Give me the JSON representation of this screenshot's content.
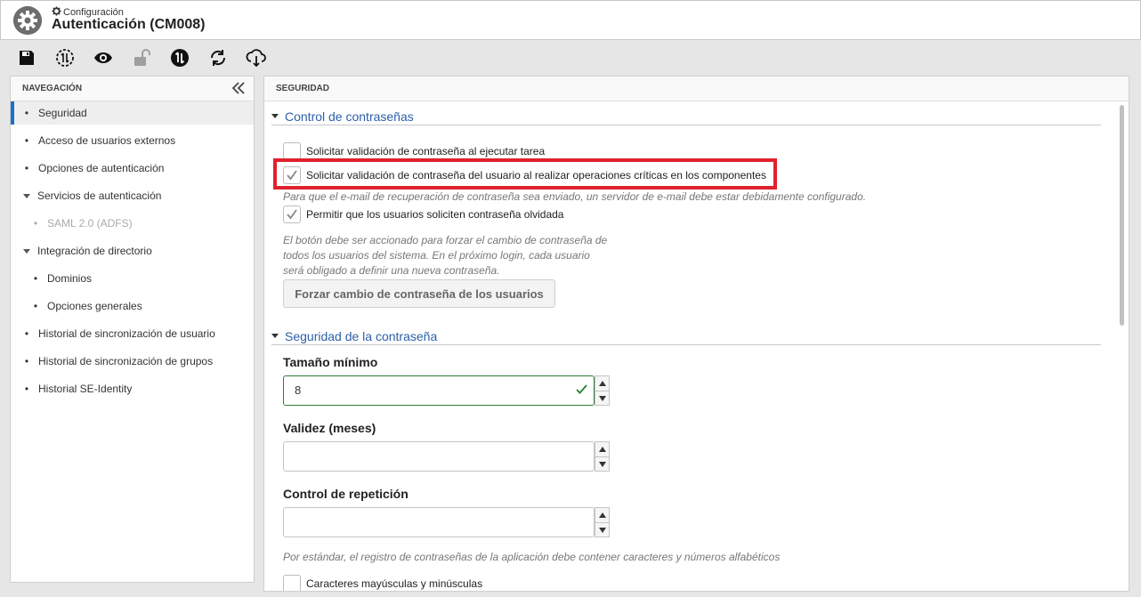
{
  "header": {
    "breadcrumb": "Configuración",
    "title": "Autenticación (CM008)"
  },
  "toolbar": {
    "buttons": [
      "save-icon",
      "sync-icon",
      "view-icon",
      "unlock-icon",
      "transfer-icon",
      "refresh-icon",
      "cloud-download-icon"
    ]
  },
  "nav": {
    "header": "NAVEGACIÓN",
    "items": [
      {
        "label": "Seguridad"
      },
      {
        "label": "Acceso de usuarios externos"
      },
      {
        "label": "Opciones de autenticación"
      },
      {
        "label": "Servicios de autenticación"
      },
      {
        "label": "SAML 2.0 (ADFS)"
      },
      {
        "label": "Integración de directorio"
      },
      {
        "label": "Dominios"
      },
      {
        "label": "Opciones generales"
      },
      {
        "label": "Historial de sincronización de usuario"
      },
      {
        "label": "Historial de sincronización de grupos"
      },
      {
        "label": "Historial SE-Identity"
      }
    ]
  },
  "main": {
    "header": "SEGURIDAD",
    "password_control": {
      "title": "Control de contraseñas",
      "cb_validate_task": {
        "label": "Solicitar validación de contraseña al ejecutar tarea",
        "checked": false
      },
      "cb_validate_critical": {
        "label": "Solicitar validación de contraseña del usuario al realizar operaciones críticas en los componentes",
        "checked": true
      },
      "hint_email": "Para que el e-mail de recuperación de contraseña sea enviado, un servidor de e-mail debe estar debidamente configurado.",
      "cb_forgot": {
        "label": "Permitir que los usuarios soliciten contraseña olvidada",
        "checked": true
      },
      "hint_force_1": "El botón debe ser accionado para forzar el cambio de contraseña de",
      "hint_force_2": "todos los usuarios del sistema. En el próximo login, cada usuario",
      "hint_force_3": "será obligado a definir una nueva contraseña.",
      "force_button": "Forzar cambio de contraseña de los usuarios"
    },
    "password_security": {
      "title": "Seguridad de la contraseña",
      "min_size_label": "Tamaño mínimo",
      "min_size_value": "8",
      "validity_label": "Validez (meses)",
      "validity_value": "",
      "repeat_label": "Control de repetición",
      "repeat_value": "",
      "hint_default": "Por estándar, el registro de contraseñas de la aplicación debe contener caracteres y números alfabéticos",
      "cb_case": {
        "label": "Caracteres mayúsculas y minúsculas",
        "checked": false
      }
    }
  },
  "colors": {
    "accent": "#1a73c8",
    "section_title": "#2b5fa8",
    "highlight": "#e0212e",
    "valid": "#2e7d32"
  }
}
